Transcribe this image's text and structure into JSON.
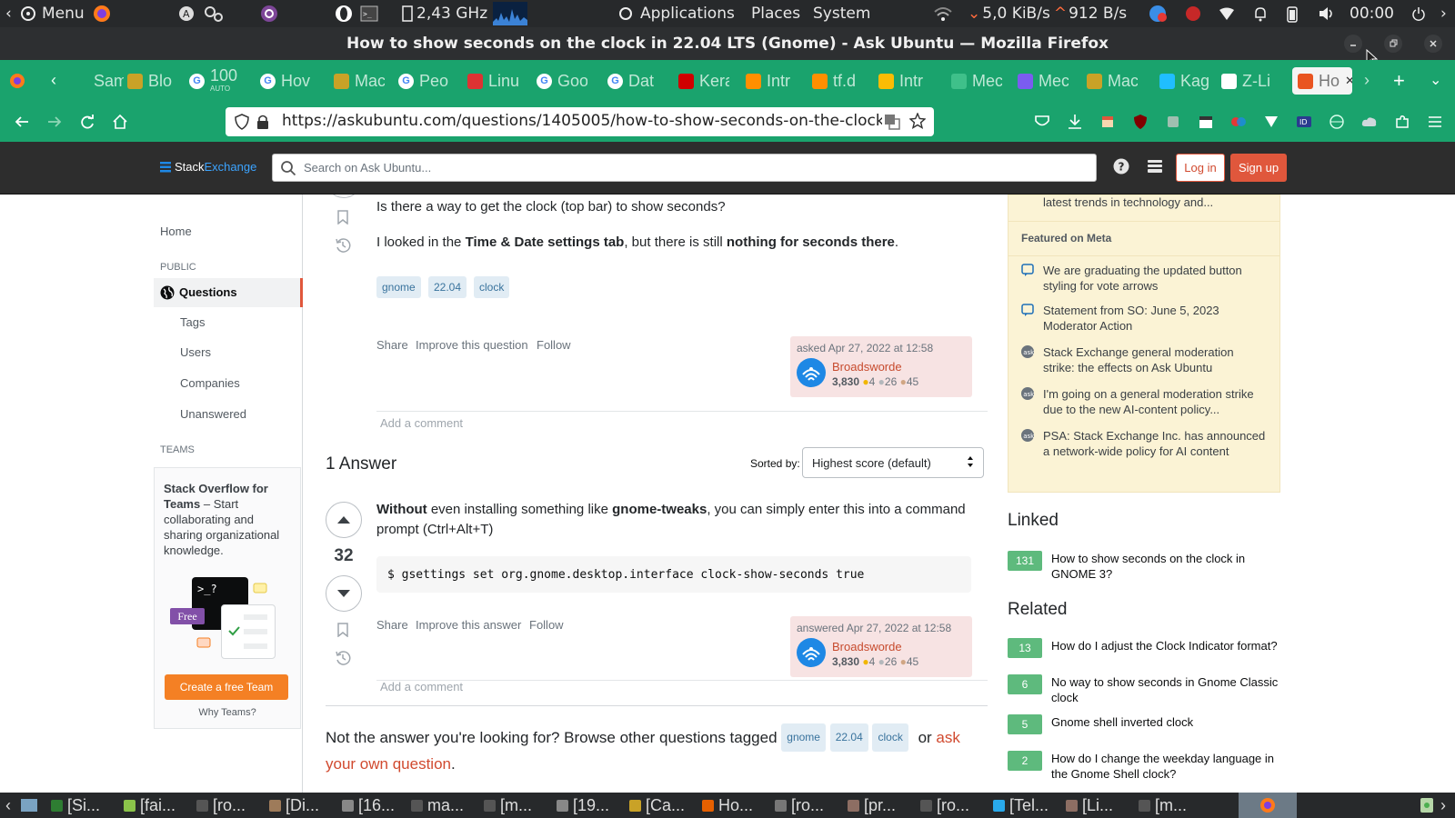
{
  "system_panel": {
    "menu_label": "Menu",
    "cpu_freq": "2,43 GHz",
    "applications": "Applications",
    "places": "Places",
    "system": "System",
    "net_down": "5,0 KiB/s",
    "net_up": "912 B/s",
    "clock": "00:00"
  },
  "window": {
    "title": "How to show seconds on the clock in 22.04 LTS (Gnome) - Ask Ubuntu — Mozilla Firefox"
  },
  "tabs": [
    {
      "label": "Sam",
      "icon": "arrow-icon",
      "color": "#1aa36d"
    },
    {
      "label": "Blo",
      "icon": "dots-icon",
      "color": "#c9a227"
    },
    {
      "label": "100",
      "sub": "AUTO",
      "icon": "google-icon",
      "color": "#ffffff"
    },
    {
      "label": "Hov",
      "icon": "google-icon",
      "color": "#ffffff"
    },
    {
      "label": "Mac",
      "icon": "dots-icon",
      "color": "#c9a227"
    },
    {
      "label": "Peo",
      "icon": "google-icon",
      "color": "#ffffff"
    },
    {
      "label": "Linu",
      "icon": "linux-icon",
      "color": "#d33"
    },
    {
      "label": "Goo",
      "icon": "google-icon",
      "color": "#ffffff"
    },
    {
      "label": "Dat",
      "icon": "google-icon",
      "color": "#ffffff"
    },
    {
      "label": "Kera",
      "icon": "keras-icon",
      "color": "#d00000"
    },
    {
      "label": "Intr",
      "icon": "tf-icon",
      "color": "#ff8f00"
    },
    {
      "label": "tf.d",
      "icon": "tf-icon",
      "color": "#ff8f00"
    },
    {
      "label": "Intr",
      "icon": "drive-icon",
      "color": "#fbbc04"
    },
    {
      "label": "Mec",
      "icon": "mountain-icon",
      "color": "#3fc08a"
    },
    {
      "label": "Mec",
      "icon": "sparkle-icon",
      "color": "#7b5cf0"
    },
    {
      "label": "Mac",
      "icon": "dots-icon",
      "color": "#c9a227"
    },
    {
      "label": "Kag",
      "icon": "kaggle-icon",
      "color": "#20beff"
    },
    {
      "label": "Z-Li",
      "icon": "wiki-icon",
      "color": "#ffffff"
    },
    {
      "label": "Ho",
      "icon": "askubuntu-icon",
      "color": "#e95420",
      "active": true
    }
  ],
  "navbar": {
    "url": "https://askubuntu.com/questions/1405005/how-to-show-seconds-on-the-clock-in-22-04-lts-gnome"
  },
  "site_header": {
    "logo_stack": "Stack",
    "logo_exchange": "Exchange",
    "search_placeholder": "Search on Ask Ubuntu...",
    "login": "Log in",
    "signup": "Sign up"
  },
  "left_nav": {
    "home": "Home",
    "public_heading": "PUBLIC",
    "questions": "Questions",
    "tags": "Tags",
    "users": "Users",
    "companies": "Companies",
    "unanswered": "Unanswered",
    "teams_heading": "TEAMS",
    "teams_title": "Stack Overflow for Teams",
    "teams_desc": " – Start collaborating and sharing organizational knowledge.",
    "free_badge": "Free",
    "terminal_text": ">_?",
    "create_team": "Create a free Team",
    "why_teams": "Why Teams?"
  },
  "question": {
    "line1": "Is there a way to get the clock (top bar) to show seconds?",
    "line2_a": "I looked in the ",
    "line2_b": "Time & Date settings tab",
    "line2_c": ", but there is still ",
    "line2_d": "nothing for seconds there",
    "line2_e": ".",
    "tags": [
      "gnome",
      "22.04",
      "clock"
    ],
    "share": "Share",
    "improve": "Improve this question",
    "follow": "Follow",
    "asked": "asked Apr 27, 2022 at 12:58",
    "user": "Broadsworde",
    "rep": "3,830",
    "gold": "4",
    "silver": "26",
    "bronze": "45",
    "add_comment": "Add a comment"
  },
  "answers_header": {
    "count": "1 Answer",
    "sorted_by": "Sorted by:",
    "sort_value": "Highest score (default)"
  },
  "answer": {
    "score": "32",
    "p_a": "Without",
    "p_b": " even installing something like ",
    "p_c": "gnome-tweaks",
    "p_d": ", you can simply enter this into a command prompt (Ctrl+Alt+T)",
    "code": "$ gsettings set org.gnome.desktop.interface clock-show-seconds true",
    "share": "Share",
    "improve": "Improve this answer",
    "follow": "Follow",
    "answered": "answered Apr 27, 2022 at 12:58",
    "user": "Broadsworde",
    "rep": "3,830",
    "gold": "4",
    "silver": "26",
    "bronze": "45",
    "add_comment": "Add a comment"
  },
  "footer_prompt": {
    "text": "Not the answer you're looking for? Browse other questions tagged",
    "tags": [
      "gnome",
      "22.04",
      "clock"
    ],
    "or": "or",
    "ask_link": "ask your own question",
    "period": "."
  },
  "right_sidebar": {
    "blog_tail": "latest trends in technology and...",
    "featured_heading": "Featured on Meta",
    "meta_items": [
      {
        "text": "We are graduating the updated button styling for vote arrows",
        "icon": "speech-bubble-icon"
      },
      {
        "text": "Statement from SO: June 5, 2023 Moderator Action",
        "icon": "speech-bubble-icon"
      },
      {
        "text": "Stack Exchange general moderation strike: the effects on Ask Ubuntu",
        "icon": "askubuntu-icon"
      },
      {
        "text": "I'm going on a general moderation strike due to the new AI-content policy...",
        "icon": "askubuntu-icon"
      },
      {
        "text": "PSA: Stack Exchange Inc. has announced a network-wide policy for AI content",
        "icon": "askubuntu-icon"
      }
    ],
    "linked_heading": "Linked",
    "linked": [
      {
        "count": "131",
        "text": "How to show seconds on the clock in GNOME 3?"
      }
    ],
    "related_heading": "Related",
    "related": [
      {
        "count": "13",
        "text": "How do I adjust the Clock Indicator format?"
      },
      {
        "count": "6",
        "text": "No way to show seconds in Gnome Classic clock"
      },
      {
        "count": "5",
        "text": "Gnome shell inverted clock"
      },
      {
        "count": "2",
        "text": "How do I change the weekday language in the Gnome Shell clock?"
      }
    ]
  },
  "taskbar": [
    {
      "label": "[Si...",
      "color": "#2e7d32"
    },
    {
      "label": "[fai...",
      "color": "#8bc34a"
    },
    {
      "label": "[ro...",
      "color": "#555"
    },
    {
      "label": "[Di...",
      "color": "#9e7b5a"
    },
    {
      "label": "[16...",
      "color": "#888"
    },
    {
      "label": "ma...",
      "color": "#555"
    },
    {
      "label": "[m...",
      "color": "#555"
    },
    {
      "label": "[19...",
      "color": "#888"
    },
    {
      "label": "[Ca...",
      "color": "#c9a227"
    },
    {
      "label": "Ho...",
      "color": "#e66000"
    },
    {
      "label": "[ro...",
      "color": "#777"
    },
    {
      "label": "[pr...",
      "color": "#8d6e63"
    },
    {
      "label": "[ro...",
      "color": "#555"
    },
    {
      "label": "[Tel...",
      "color": "#29a9eb"
    },
    {
      "label": "[Li...",
      "color": "#8d6e63"
    },
    {
      "label": "[m...",
      "color": "#555"
    }
  ],
  "colors": {
    "accent_green": "#1aa36d",
    "so_orange": "#e0573c",
    "tag_bg": "#e1ecf4",
    "tag_fg": "#39739d",
    "answered_green": "#5eba7d",
    "featured_bg": "#fbf3d5"
  }
}
